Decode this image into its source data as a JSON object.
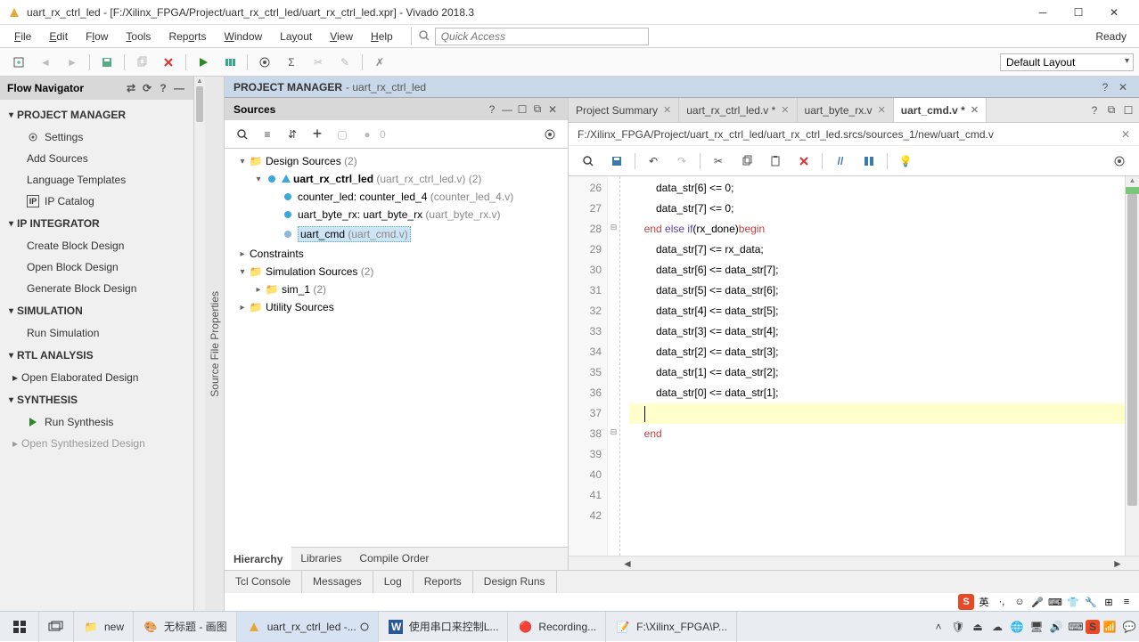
{
  "titlebar": {
    "text": "uart_rx_ctrl_led - [F:/Xilinx_FPGA/Project/uart_rx_ctrl_led/uart_rx_ctrl_led.xpr] - Vivado 2018.3"
  },
  "menubar": {
    "items": [
      "File",
      "Edit",
      "Flow",
      "Tools",
      "Reports",
      "Window",
      "Layout",
      "View",
      "Help"
    ],
    "quick_access_placeholder": "Quick Access",
    "ready": "Ready"
  },
  "toolbar": {
    "layout_label": "Default Layout"
  },
  "flow_nav": {
    "title": "Flow Navigator",
    "sections": [
      {
        "label": "PROJECT MANAGER",
        "items": [
          {
            "label": "Settings",
            "icon": "gear"
          },
          {
            "label": "Add Sources"
          },
          {
            "label": "Language Templates"
          },
          {
            "label": "IP Catalog",
            "icon": "ip"
          }
        ]
      },
      {
        "label": "IP INTEGRATOR",
        "items": [
          {
            "label": "Create Block Design"
          },
          {
            "label": "Open Block Design"
          },
          {
            "label": "Generate Block Design"
          }
        ]
      },
      {
        "label": "SIMULATION",
        "items": [
          {
            "label": "Run Simulation"
          }
        ]
      },
      {
        "label": "RTL ANALYSIS",
        "items": [
          {
            "label": "Open Elaborated Design",
            "expandable": true
          }
        ]
      },
      {
        "label": "SYNTHESIS",
        "items": [
          {
            "label": "Run Synthesis",
            "icon": "run"
          },
          {
            "label": "Open Synthesized Design",
            "disabled": true,
            "expandable": true
          }
        ]
      }
    ]
  },
  "vtab": {
    "label": "Source File Properties"
  },
  "pm_header": {
    "title": "PROJECT MANAGER",
    "sub": " - uart_rx_ctrl_led"
  },
  "sources": {
    "title": "Sources",
    "tree": {
      "design_sources": {
        "label": "Design Sources",
        "count": "(2)"
      },
      "top": {
        "name": "uart_rx_ctrl_led",
        "file": "(uart_rx_ctrl_led.v)",
        "count": "(2)"
      },
      "child1": {
        "inst": "counter_led",
        "mod": " : counter_led_4",
        "file": "(counter_led_4.v)"
      },
      "child2": {
        "inst": "uart_byte_rx",
        "mod": " : uart_byte_rx",
        "file": "(uart_byte_rx.v)"
      },
      "child3": {
        "name": "uart_cmd",
        "file": "(uart_cmd.v)"
      },
      "constraints": {
        "label": "Constraints"
      },
      "sim_sources": {
        "label": "Simulation Sources",
        "count": "(2)"
      },
      "sim1": {
        "label": "sim_1",
        "count": "(2)"
      },
      "utility": {
        "label": "Utility Sources"
      }
    },
    "tabs": [
      "Hierarchy",
      "Libraries",
      "Compile Order"
    ],
    "zero": "0"
  },
  "editor": {
    "tabs": [
      {
        "label": "Project Summary"
      },
      {
        "label": "uart_rx_ctrl_led.v *"
      },
      {
        "label": "uart_byte_rx.v"
      },
      {
        "label": "uart_cmd.v *",
        "active": true
      }
    ],
    "path": "F:/Xilinx_FPGA/Project/uart_rx_ctrl_led/uart_rx_ctrl_led.srcs/sources_1/new/uart_cmd.v",
    "lines": [
      {
        "n": 26,
        "text": "         data_str[6] <= 0;"
      },
      {
        "n": 27,
        "text": "         data_str[7] <= 0;"
      },
      {
        "n": 28,
        "text": "     end else if(rx_done)begin",
        "kw": true,
        "fold": "⊟"
      },
      {
        "n": 29,
        "text": "         data_str[7] <= rx_data;"
      },
      {
        "n": 30,
        "text": "         data_str[6] <= data_str[7];"
      },
      {
        "n": 31,
        "text": "         data_str[5] <= data_str[6];"
      },
      {
        "n": 32,
        "text": "         data_str[4] <= data_str[5];"
      },
      {
        "n": 33,
        "text": "         data_str[3] <= data_str[4];"
      },
      {
        "n": 34,
        "text": "         data_str[2] <= data_str[3];"
      },
      {
        "n": 35,
        "text": "         data_str[1] <= data_str[2];"
      },
      {
        "n": 36,
        "text": "         data_str[0] <= data_str[1];"
      },
      {
        "n": 37,
        "text": "     ",
        "cursor": true
      },
      {
        "n": 38,
        "text": "     end",
        "endkw": true,
        "fold": "⊟"
      },
      {
        "n": 39,
        "text": ""
      },
      {
        "n": 40,
        "text": ""
      },
      {
        "n": 41,
        "text": ""
      },
      {
        "n": 42,
        "text": ""
      }
    ]
  },
  "bottom_tabs": [
    "Tcl Console",
    "Messages",
    "Log",
    "Reports",
    "Design Runs"
  ],
  "taskbar": {
    "items": [
      {
        "label": "",
        "icon": "start"
      },
      {
        "label": "",
        "icon": "taskview"
      },
      {
        "label": "new",
        "icon": "folder"
      },
      {
        "label": "无标题 - 画图",
        "icon": "paint"
      },
      {
        "label": "uart_rx_ctrl_led -...",
        "icon": "vivado",
        "active": true
      },
      {
        "label": "使用串口来控制L...",
        "icon": "word"
      },
      {
        "label": "Recording...",
        "icon": "rec"
      },
      {
        "label": "F:\\Xilinx_FPGA\\P...",
        "icon": "npp"
      }
    ],
    "ime": "英"
  }
}
